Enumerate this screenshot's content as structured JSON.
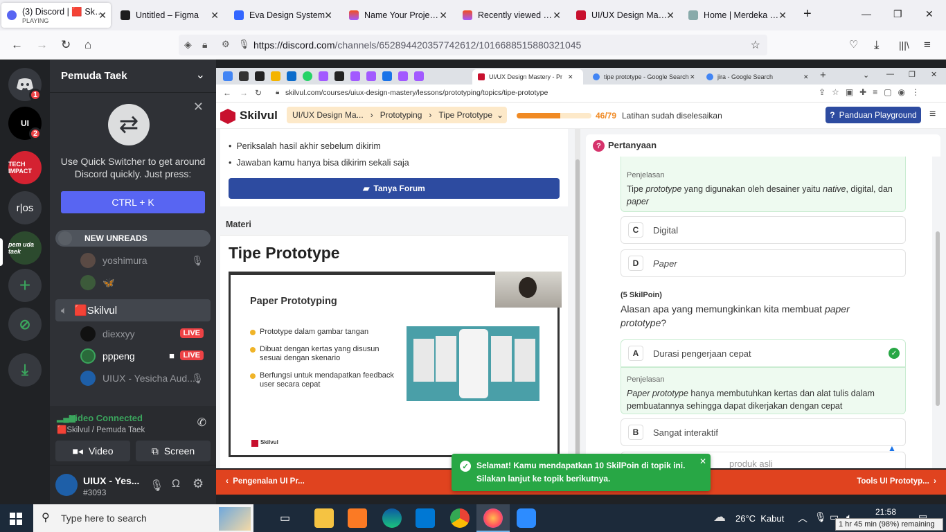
{
  "browser": {
    "tabs": [
      {
        "title": "(3) Discord | 🟥 Skilvul",
        "sub": "PLAYING",
        "active": true
      },
      {
        "title": "Untitled – Figma"
      },
      {
        "title": "Eva Design System"
      },
      {
        "title": "Name Your Project – Figma"
      },
      {
        "title": "Recently viewed – Figma"
      },
      {
        "title": "UI/UX Design Mastery"
      },
      {
        "title": "Home | Merdeka Belajar"
      }
    ],
    "url_host": "https://discord.com",
    "url_path": "/channels/652894420357742612/1016688515880321045"
  },
  "discord": {
    "server_name": "Pemuda Taek",
    "guild_badges": [
      "1",
      "2"
    ],
    "guild_text": "r|os",
    "quick_switcher_text": "Use Quick Switcher to get around Discord quickly. Just press:",
    "quick_switcher_button": "CTRL + K",
    "new_unreads": "NEW UNREADS",
    "members_top": [
      "yoshimura",
      "🦋"
    ],
    "voice_channel": "🟥Skilvul",
    "voice_members": [
      {
        "name": "diexxyy",
        "live": "LIVE"
      },
      {
        "name": "pppeng",
        "live": "LIVE"
      },
      {
        "name": "UIUX - Yesicha Aud..."
      }
    ],
    "video_connected": "Video Connected",
    "voice_path": "🟥Skilvul / Pemuda Taek",
    "video_button": "Video",
    "screen_button": "Screen",
    "user_name": "UIUX - Yes...",
    "user_tag": "#3093"
  },
  "inner_browser": {
    "tabs": [
      "UI/UX Design Mastery - Pr",
      "tipe prototype - Google Search",
      "jira - Google Search"
    ],
    "url": "skilvul.com/courses/uiux-design-mastery/lessons/prototyping/topics/tipe-prototype"
  },
  "skilvul": {
    "logo": "Skilvul",
    "breadcrumb": [
      "UI/UX Design Ma...",
      "Prototyping",
      "Tipe Prototype"
    ],
    "progress_text": "46/79",
    "progress": 0.58,
    "progress_label": "Latihan sudah diselesaikan",
    "guide_button": "Panduan Playground",
    "rules": [
      "Periksalah hasil akhir sebelum dikirim",
      "Jawaban kamu hanya bisa dikirim sekali saja"
    ],
    "forum_button": "Tanya Forum",
    "materi_label": "Materi",
    "materi_title": "Tipe Prototype",
    "slide_title": "Paper Prototyping",
    "slide_bullets": [
      "Prototype dalam gambar tangan",
      "Dibuat dengan kertas yang disusun sesuai dengan skenario",
      "Berfungsi untuk mendapatkan feedback user secara cepat"
    ],
    "slide_logo": "Skilvul",
    "question_header": "Pertanyaan",
    "q1_expl_label": "Penjelasan",
    "q1_expl_parts": [
      "Tipe ",
      "prototype",
      " yang digunakan oleh desainer yaitu ",
      "native",
      ", digital, dan ",
      "paper"
    ],
    "q1_options": [
      {
        "letter": "C",
        "text": "Digital"
      },
      {
        "letter": "D",
        "text": "Paper"
      }
    ],
    "q2_points": "(5 SkilPoin)",
    "q2_parts": [
      "Alasan apa yang memungkinkan kita membuat ",
      "paper prototype",
      "?"
    ],
    "q2_option_a": {
      "letter": "A",
      "text": "Durasi pengerjaan cepat"
    },
    "q2_expl_label": "Penjelasan",
    "q2_expl_parts": [
      "Paper prototype",
      " hanya membutuhkan kertas dan alat tulis dalam pembuatannya sehingga dapat dikerjakan dengan cepat"
    ],
    "q2_option_b": {
      "letter": "B",
      "text": "Sangat interaktif"
    },
    "q2_option_c_partial": "produk asli",
    "toast_line1": "Selamat! Kamu mendapatkan 10 SkilPoin di topik ini.",
    "toast_line2": "Silakan lanjut ke topik berikutnya.",
    "prev_topic": "Pengenalan UI Pr...",
    "next_topic": "Tools UI Prototyp..."
  },
  "taskbar": {
    "search_placeholder": "Type here to search",
    "weather": "26°C  Kabut",
    "time": "21:58",
    "battery": "1 hr 45 min (98%) remaining"
  }
}
